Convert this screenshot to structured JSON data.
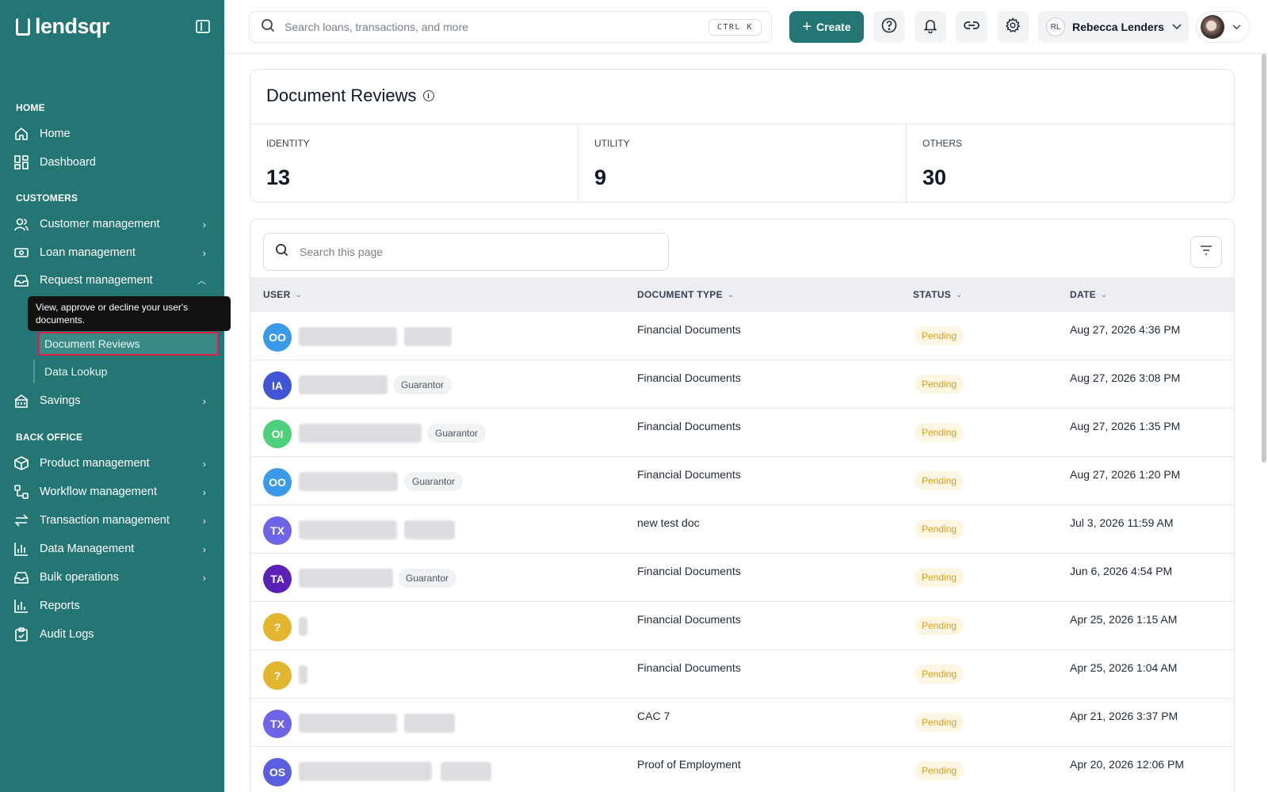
{
  "brand": {
    "name": "lendsqr"
  },
  "sidebar": {
    "sections": {
      "home": "HOME",
      "customers": "CUSTOMERS",
      "back_office": "BACK OFFICE"
    },
    "items": {
      "home": "Home",
      "dashboard": "Dashboard",
      "customer_management": "Customer management",
      "loan_management": "Loan management",
      "request_management": "Request management",
      "document_reviews": "Document Reviews",
      "data_lookup": "Data Lookup",
      "savings": "Savings",
      "product_management": "Product management",
      "workflow_management": "Workflow management",
      "transaction_management": "Transaction management",
      "data_management": "Data Management",
      "bulk_operations": "Bulk operations",
      "reports": "Reports",
      "audit_logs": "Audit Logs"
    },
    "tooltip": "View, approve or decline your user's documents."
  },
  "topbar": {
    "search_placeholder": "Search loans, transactions, and more",
    "shortcut": "CTRL K",
    "create_label": "Create",
    "user_initials": "RL",
    "user_name": "Rebecca Lenders"
  },
  "summary": {
    "title": "Document Reviews",
    "stats": [
      {
        "label": "IDENTITY",
        "value": "13"
      },
      {
        "label": "UTILITY",
        "value": "9"
      },
      {
        "label": "OTHERS",
        "value": "30"
      }
    ]
  },
  "table": {
    "search_placeholder": "Search this page",
    "columns": [
      "USER",
      "DOCUMENT TYPE",
      "STATUS",
      "DATE"
    ],
    "rows": [
      {
        "initials": "OO",
        "color": "#3b9ae8",
        "tag": "",
        "doc_type": "Financial Documents",
        "status": "Pending",
        "date": "Aug 27, 2026 4:36 PM"
      },
      {
        "initials": "IA",
        "color": "#3f55d6",
        "tag": "Guarantor",
        "doc_type": "Financial Documents",
        "status": "Pending",
        "date": "Aug 27, 2026 3:08 PM"
      },
      {
        "initials": "OI",
        "color": "#4cd07a",
        "tag": "Guarantor",
        "doc_type": "Financial Documents",
        "status": "Pending",
        "date": "Aug 27, 2026 1:35 PM"
      },
      {
        "initials": "OO",
        "color": "#3b9ae8",
        "tag": "Guarantor",
        "doc_type": "Financial Documents",
        "status": "Pending",
        "date": "Aug 27, 2026 1:20 PM"
      },
      {
        "initials": "TX",
        "color": "#6d64e8",
        "tag": "",
        "doc_type": "new test doc",
        "status": "Pending",
        "date": "Jul 3, 2026 11:59 AM"
      },
      {
        "initials": "TA",
        "color": "#5b21b6",
        "tag": "Guarantor",
        "doc_type": "Financial Documents",
        "status": "Pending",
        "date": "Jun 6, 2026 4:54 PM"
      },
      {
        "initials": "?",
        "color": "#e3b62f",
        "tag": "",
        "doc_type": "Financial Documents",
        "status": "Pending",
        "date": "Apr 25, 2026 1:15 AM"
      },
      {
        "initials": "?",
        "color": "#e3b62f",
        "tag": "",
        "doc_type": "Financial Documents",
        "status": "Pending",
        "date": "Apr 25, 2026 1:04 AM"
      },
      {
        "initials": "TX",
        "color": "#6d64e8",
        "tag": "",
        "doc_type": "CAC 7",
        "status": "Pending",
        "date": "Apr 21, 2026 3:37 PM"
      },
      {
        "initials": "OS",
        "color": "#5a5fe0",
        "tag": "",
        "doc_type": "Proof of Employment",
        "status": "Pending",
        "date": "Apr 20, 2026 12:06 PM"
      }
    ]
  },
  "colors": {
    "sidebar_bg": "#237673",
    "accent": "#237673",
    "pending_text": "#d4a017",
    "active_outline": "#e11d48"
  }
}
